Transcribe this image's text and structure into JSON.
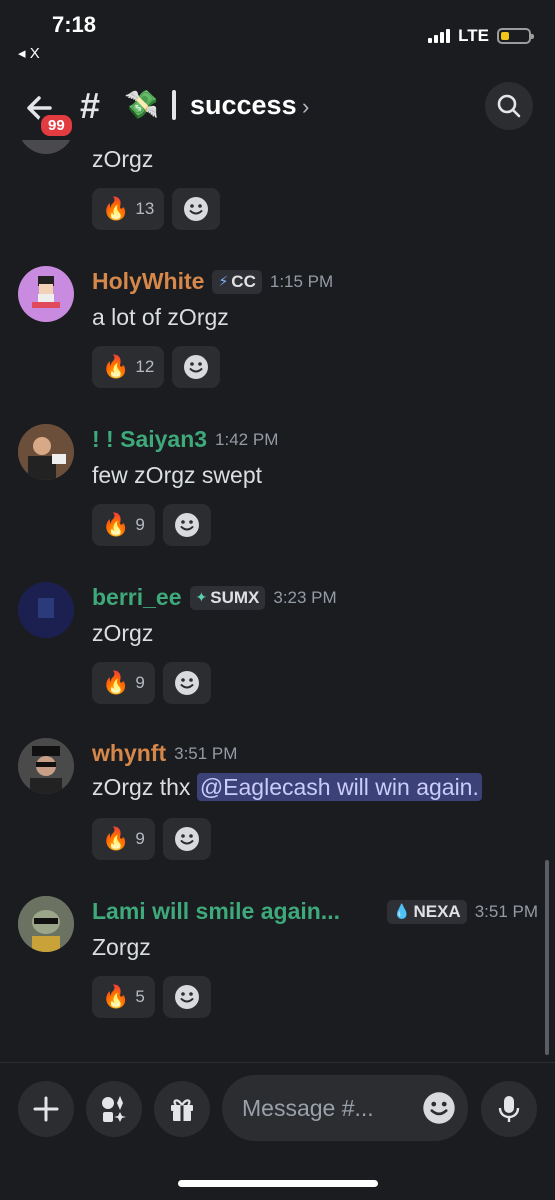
{
  "status_bar": {
    "time": "7:18",
    "back_app": "◂ X",
    "network": "LTE",
    "battery_level": 0.3
  },
  "header": {
    "unread_badge": "99",
    "hash": "#",
    "channel_emoji": "💸",
    "channel_name": "success",
    "chevron": "›"
  },
  "colors": {
    "orange_name": "#d6874a",
    "green_name": "#3ea97a",
    "mention_bg": "#3c4178"
  },
  "messages": [
    {
      "author": "",
      "tag": "",
      "time": "",
      "text": "zOrgz",
      "reaction_emoji": "🔥",
      "reaction_count": "13"
    },
    {
      "author": "HolyWhite",
      "tag": "CC",
      "tag_icon": "⚡",
      "time": "1:15 PM",
      "text": "a lot of zOrgz",
      "reaction_emoji": "🔥",
      "reaction_count": "12"
    },
    {
      "author": "! ! Saiyan3",
      "tag": "",
      "time": "1:42 PM",
      "text": "few zOrgz swept",
      "reaction_emoji": "🔥",
      "reaction_count": "9"
    },
    {
      "author": "berri_ee",
      "tag": "SUMX",
      "tag_icon": "✦",
      "time": "3:23 PM",
      "text": "zOrgz",
      "reaction_emoji": "🔥",
      "reaction_count": "9"
    },
    {
      "author": "whynft",
      "tag": "",
      "time": "3:51 PM",
      "text": "zOrgz thx ",
      "mention": "@Eaglecash will win again.",
      "reaction_emoji": "🔥",
      "reaction_count": "9"
    },
    {
      "author": "Lami will smile again...",
      "tag": "NEXA",
      "tag_icon": "💧",
      "time": "3:51 PM",
      "text": "Zorgz",
      "reaction_emoji": "🔥",
      "reaction_count": "5"
    }
  ],
  "composer": {
    "placeholder": "Message #..."
  }
}
